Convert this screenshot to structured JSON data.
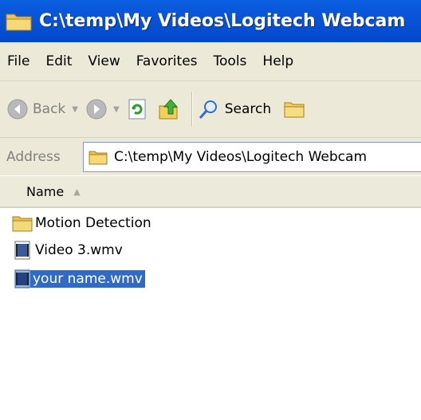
{
  "window": {
    "title": "C:\\temp\\My Videos\\Logitech Webcam"
  },
  "menu": {
    "items": [
      "File",
      "Edit",
      "View",
      "Favorites",
      "Tools",
      "Help"
    ]
  },
  "toolbar": {
    "back_label": "Back",
    "search_label": "Search"
  },
  "address": {
    "label": "Address",
    "value": "C:\\temp\\My Videos\\Logitech Webcam"
  },
  "columns": {
    "name": "Name"
  },
  "files": [
    {
      "name": "Motion Detection",
      "type": "folder",
      "selected": false
    },
    {
      "name": "Video 3.wmv",
      "type": "video",
      "selected": false
    },
    {
      "name": "your name.wmv",
      "type": "video",
      "selected": true
    }
  ],
  "colors": {
    "titlebar": "#0a52d6",
    "selection": "#316ac5",
    "chrome": "#ece9d8"
  }
}
